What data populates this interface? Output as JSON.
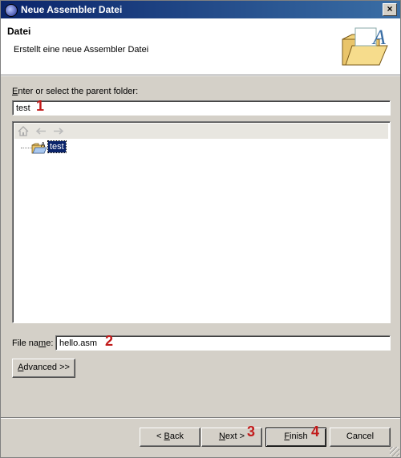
{
  "window": {
    "title": "Neue Assembler Datei",
    "close_label": "×"
  },
  "header": {
    "title": "Datei",
    "description": "Erstellt eine neue Assembler Datei"
  },
  "parent_folder": {
    "label_prefix": "E",
    "label_rest": "nter or select the parent folder:",
    "value": "test",
    "badge": "1"
  },
  "tree": {
    "toolbar_icons": [
      "home-icon",
      "back-arrow-icon",
      "forward-arrow-icon"
    ],
    "items": [
      {
        "label": "test",
        "icon": "project-folder-icon",
        "selected": true
      }
    ]
  },
  "file_name": {
    "label_pre": "File na",
    "label_mnemonic": "m",
    "label_post": "e:",
    "value": "hello.asm",
    "badge": "2"
  },
  "advanced": {
    "label_mnemonic": "A",
    "label_rest": "dvanced >>"
  },
  "buttons": {
    "back_pre": "< ",
    "back_mnemonic": "B",
    "back_rest": "ack",
    "next_mnemonic": "N",
    "next_rest": "ext >",
    "next_badge": "3",
    "finish_mnemonic": "F",
    "finish_rest": "inish",
    "finish_badge": "4",
    "cancel": "Cancel"
  },
  "colors": {
    "titlebar_start": "#0a246a",
    "titlebar_end": "#3a6ea5",
    "badge": "#c21b1b",
    "selection": "#0a246a"
  }
}
